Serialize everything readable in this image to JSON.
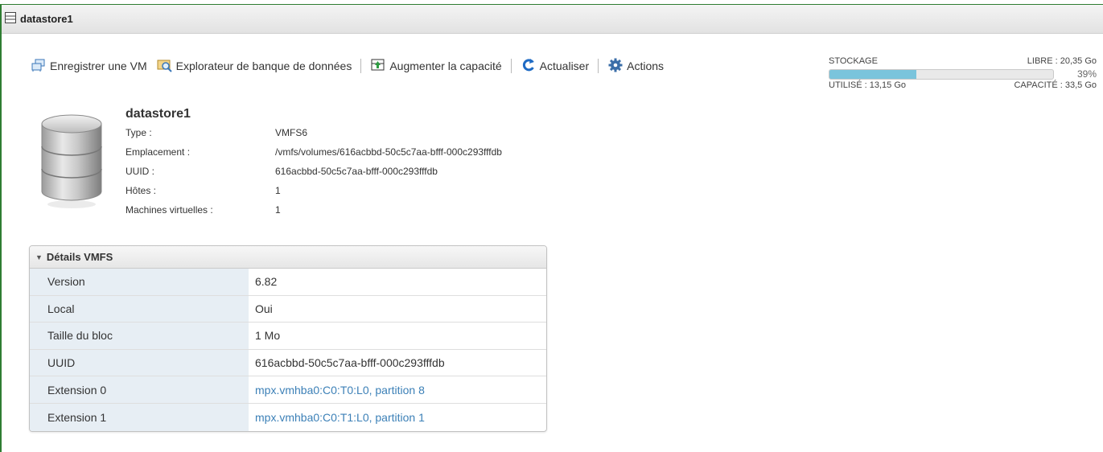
{
  "window": {
    "title": "datastore1"
  },
  "toolbar": {
    "register_vm": "Enregistrer une VM",
    "datastore_browser": "Explorateur de banque de données",
    "increase_capacity": "Augmenter la capacité",
    "refresh": "Actualiser",
    "actions": "Actions"
  },
  "storage": {
    "label": "STOCKAGE",
    "free": "LIBRE : 20,35 Go",
    "percent": "39%",
    "used_fraction": 0.39,
    "used": "UTILISÉ : 13,15 Go",
    "capacity": "CAPACITÉ : 33,5 Go"
  },
  "datastore": {
    "name": "datastore1",
    "properties": [
      {
        "key": "Type :",
        "value": "VMFS6"
      },
      {
        "key": "Emplacement :",
        "value": "/vmfs/volumes/616acbbd-50c5c7aa-bfff-000c293fffdb"
      },
      {
        "key": "UUID :",
        "value": "616acbbd-50c5c7aa-bfff-000c293fffdb"
      },
      {
        "key": "Hôtes :",
        "value": "1"
      },
      {
        "key": "Machines virtuelles :",
        "value": "1"
      }
    ]
  },
  "vmfs_details": {
    "title": "Détails VMFS",
    "rows": [
      {
        "key": "Version",
        "value": "6.82"
      },
      {
        "key": "Local",
        "value": "Oui"
      },
      {
        "key": "Taille du bloc",
        "value": "1 Mo"
      },
      {
        "key": "UUID",
        "value": "616acbbd-50c5c7aa-bfff-000c293fffdb"
      },
      {
        "key": "Extension 0",
        "value": "mpx.vmhba0:C0:T0:L0, partition 8"
      },
      {
        "key": "Extension 1",
        "value": "mpx.vmhba0:C0:T1:L0, partition 1"
      }
    ]
  },
  "colors": {
    "accent": "#3c80b7",
    "storage_fill": "#7ac4dc",
    "frame_border": "#2f7d32"
  }
}
